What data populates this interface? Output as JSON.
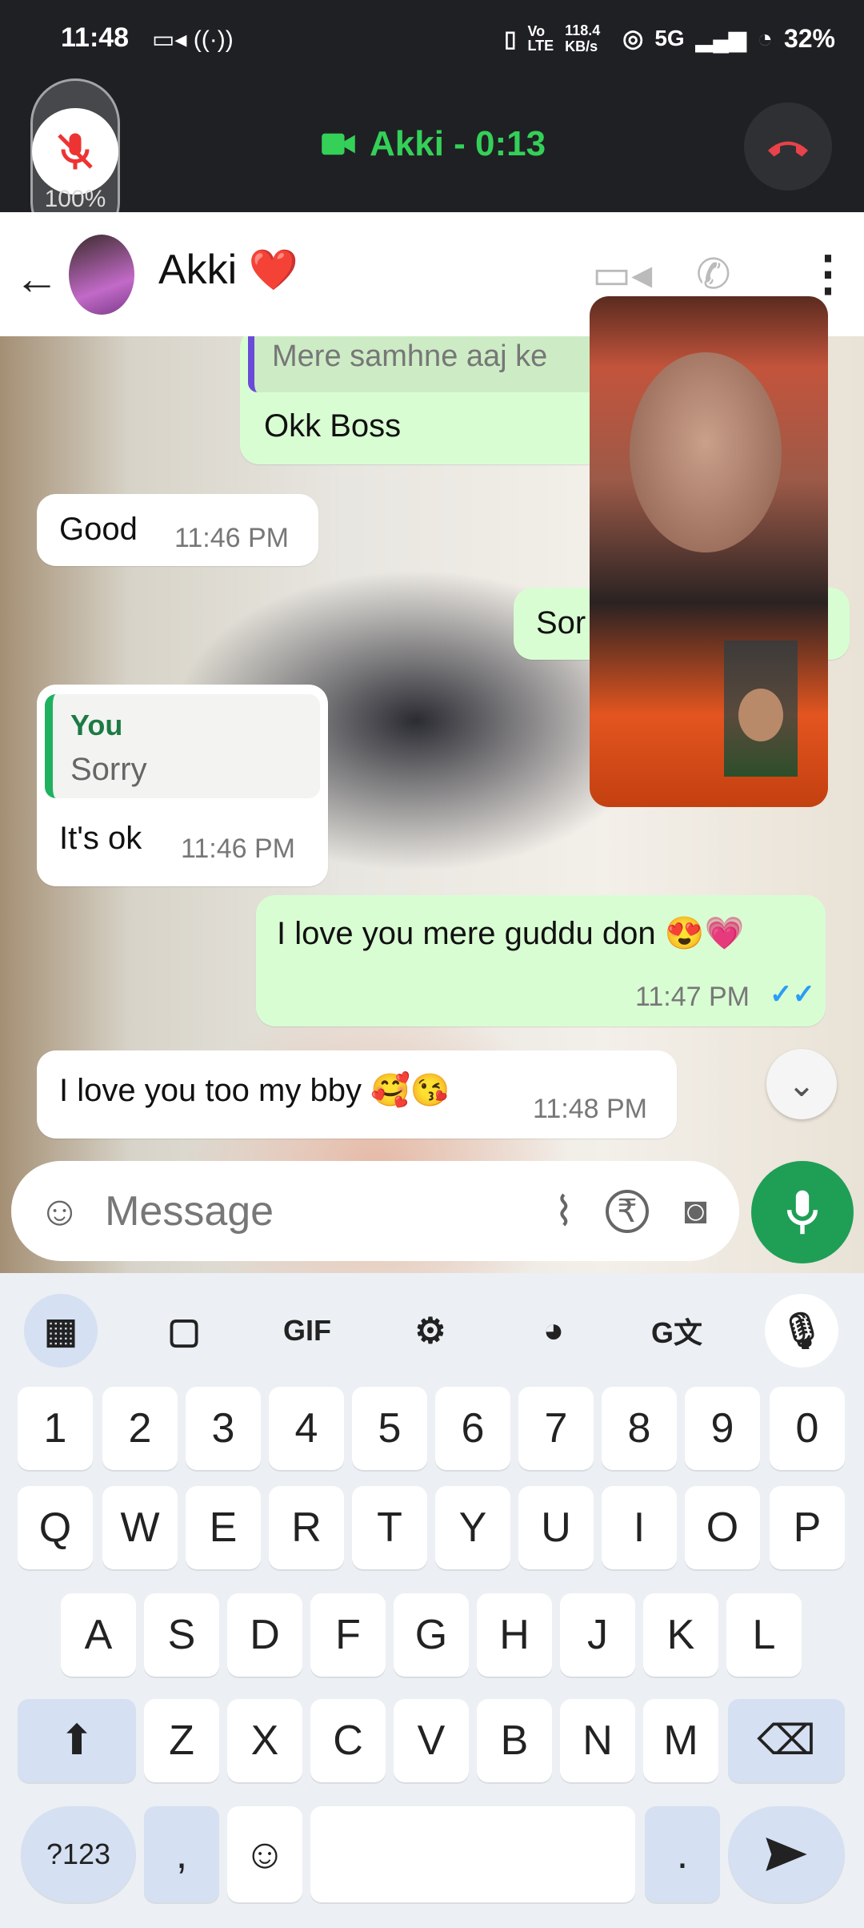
{
  "status": {
    "time": "11:48",
    "net_speed": "118.4 KB/s",
    "network": "5G",
    "battery": "32%"
  },
  "call": {
    "title": "Akki - 0:13",
    "zoom": "100%"
  },
  "header": {
    "contact_name": "Akki",
    "contact_emoji": "❤️"
  },
  "messages": [
    {
      "dir": "out",
      "quote_text": "Mere samhne aaj ke",
      "text": "Okk Boss",
      "time": ""
    },
    {
      "dir": "in",
      "text": "Good",
      "time": "11:46 PM"
    },
    {
      "dir": "out",
      "text": "Sor",
      "time": ""
    },
    {
      "dir": "in",
      "quote_author": "You",
      "quote_text": "Sorry",
      "text": "It's ok",
      "time": "11:46 PM"
    },
    {
      "dir": "out",
      "text": "I love you mere guddu don 😍💗",
      "time": "11:47 PM"
    },
    {
      "dir": "in",
      "text": "I love you too my bby 🥰😘",
      "time": "11:48 PM"
    }
  ],
  "composer": {
    "placeholder": "Message"
  },
  "keyboard": {
    "toolbar": [
      "apps-grid",
      "sticker",
      "GIF",
      "settings",
      "palette",
      "translate",
      "mic"
    ],
    "gif_label": "GIF",
    "row_numbers": [
      "1",
      "2",
      "3",
      "4",
      "5",
      "6",
      "7",
      "8",
      "9",
      "0"
    ],
    "row_q": [
      "Q",
      "W",
      "E",
      "R",
      "T",
      "Y",
      "U",
      "I",
      "O",
      "P"
    ],
    "row_a": [
      "A",
      "S",
      "D",
      "F",
      "G",
      "H",
      "J",
      "K",
      "L"
    ],
    "row_z": [
      "Z",
      "X",
      "C",
      "V",
      "B",
      "N",
      "M"
    ],
    "symbols_label": "?123",
    "comma": ",",
    "period": "."
  },
  "colors": {
    "accent_green": "#1f9e56",
    "outgoing_bubble": "#d9fdd3",
    "call_green": "#34d058",
    "end_call_red": "#e8424a"
  }
}
